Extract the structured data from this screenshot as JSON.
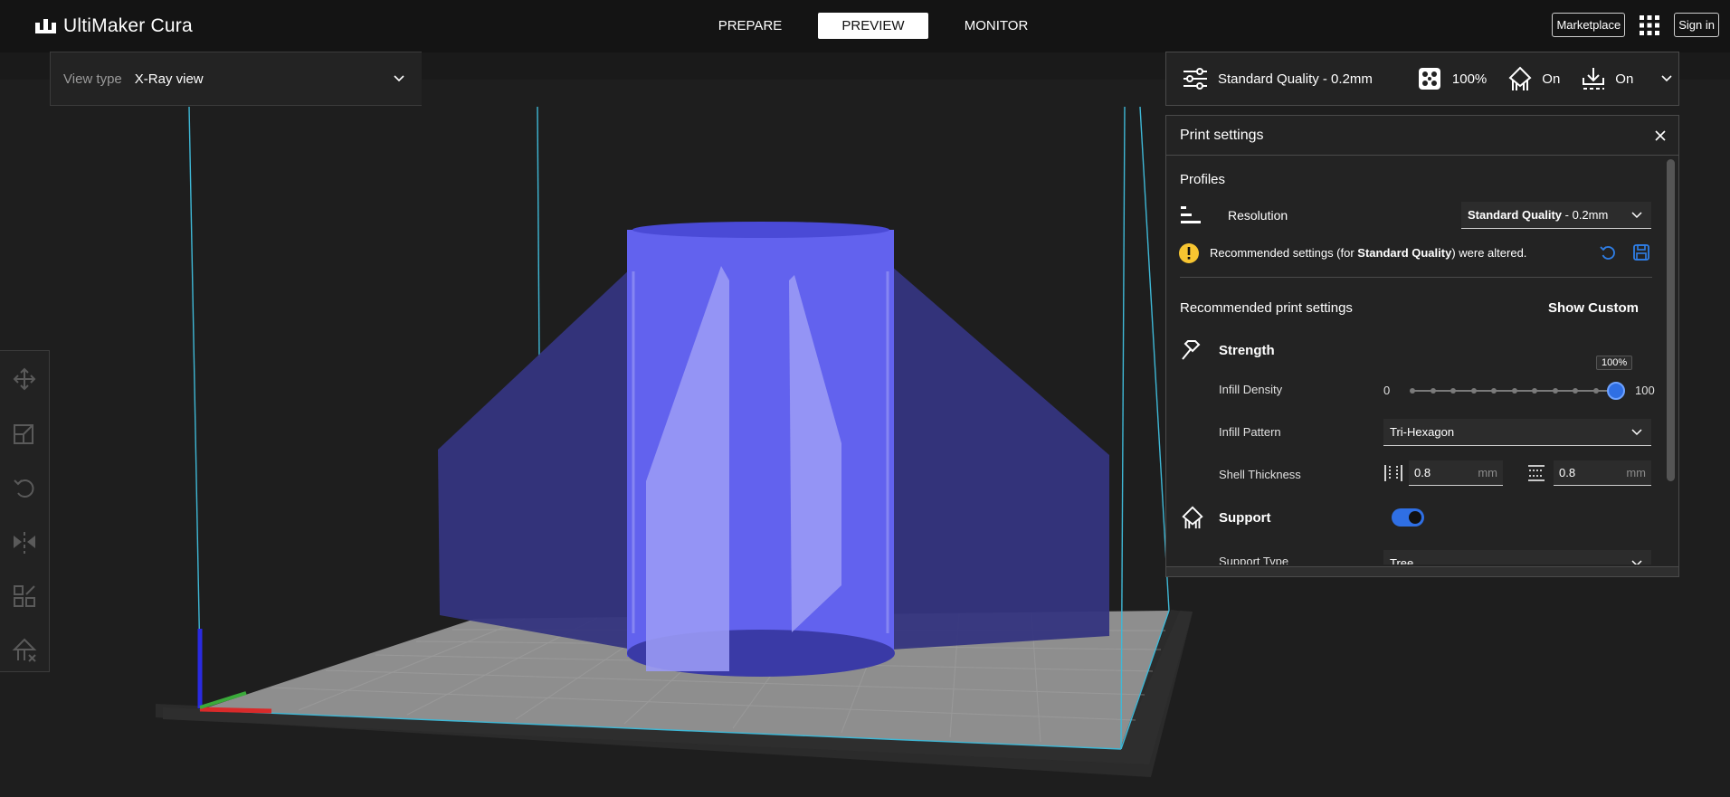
{
  "app": {
    "name": "UltiMaker Cura"
  },
  "stages": [
    {
      "label": "PREPARE",
      "active": false
    },
    {
      "label": "PREVIEW",
      "active": true
    },
    {
      "label": "MONITOR",
      "active": false
    }
  ],
  "header_right": {
    "marketplace": "Marketplace",
    "sign_in": "Sign in"
  },
  "view_type": {
    "label": "View type",
    "value": "X-Ray view"
  },
  "toolbar": [
    "move-tool-icon",
    "scale-tool-icon",
    "rotate-tool-icon",
    "mirror-tool-icon",
    "per-model-settings-icon",
    "support-blocker-icon"
  ],
  "print_strip": {
    "profile": "Standard Quality - 0.2mm",
    "infill": "100%",
    "support": "On",
    "adhesion": "On"
  },
  "print_settings": {
    "title": "Print settings",
    "profiles_heading": "Profiles",
    "resolution_label": "Resolution",
    "resolution_value_bold": "Standard Quality",
    "resolution_value_rest": " - 0.2mm",
    "warning_prefix": "Recommended settings (for ",
    "warning_bold": "Standard Quality",
    "warning_suffix": ") were altered.",
    "recommended_heading": "Recommended print settings",
    "show_custom": "Show Custom",
    "strength_heading": "Strength",
    "infill_density_label": "Infill Density",
    "infill_min": "0",
    "infill_max": "100",
    "infill_value": "100%",
    "infill_fraction": 1.0,
    "infill_pattern_label": "Infill Pattern",
    "infill_pattern_value": "Tri-Hexagon",
    "shell_label": "Shell Thickness",
    "wall_value": "0.8",
    "top_bottom_value": "0.8",
    "unit": "mm",
    "support_heading": "Support",
    "support_enabled": true,
    "support_type_label": "Support Type",
    "support_type_value": "Tree"
  },
  "colors": {
    "accent": "#2f6fe4",
    "model_dark": "#35357f",
    "model_mid": "#6262ee",
    "model_light": "#9a9af5",
    "build_volume": "#3fb8d6",
    "warning": "#f7c531"
  }
}
